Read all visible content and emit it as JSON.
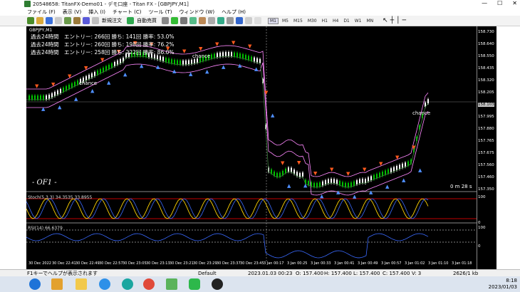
{
  "window": {
    "title": "20548658: TitanFX-Demo01 - デモ口座 - Titan FX - [GBPJPY,M1]",
    "minimize": "—",
    "maximize": "☐",
    "close": "✕"
  },
  "menu": [
    "ファイル (F)",
    "表示 (V)",
    "挿入 (I)",
    "チャート (C)",
    "ツール (T)",
    "ウィンドウ (W)",
    "ヘルプ (H)"
  ],
  "toolbar": {
    "new_order": "新規注文",
    "auto_trade": "自動売買",
    "timeframes": [
      "M1",
      "M5",
      "M15",
      "M30",
      "H1",
      "H4",
      "D1",
      "W1",
      "MN"
    ],
    "active_timeframe": "M1"
  },
  "chart": {
    "symbol_label": "GBPJPY,M1",
    "stats": [
      "過去24時間　エントリー: 266回  勝ち: 141回  勝率: 53.0%",
      "過去24時間　エントリー: 260回  勝ち: 198回  勝率: 76.2%",
      "過去24時間　エントリー: 258回  勝ち: 222回  勝率: 86.0%"
    ],
    "chance_labels": [
      "chance",
      "chance",
      "chance"
    ],
    "watermark": "- OF1 -",
    "countdown": "0 m 28 s",
    "current_price": "158.103",
    "stoch_label": "Stoch(5,3,3) 34.3535 33.8955",
    "rsi_label": "RSI(14) 66.6379",
    "price_ticks": [
      "158.730",
      "158.640",
      "158.550",
      "158.435",
      "158.320",
      "158.205",
      "158.103",
      "157.995",
      "157.880",
      "157.765",
      "157.675",
      "157.560",
      "157.460",
      "157.350"
    ],
    "osc_ticks": [
      "100",
      "0",
      "100",
      "0"
    ],
    "time_ticks": [
      "30 Dec 2022",
      "30 Dec 22:41",
      "30 Dec 22:49",
      "30 Dec 22:57",
      "30 Dec 23:05",
      "30 Dec 23:13",
      "30 Dec 23:21",
      "30 Dec 23:29",
      "30 Dec 23:37",
      "30 Dec 23:45",
      "3 Jan 00:17",
      "3 Jan 00:25",
      "3 Jan 00:33",
      "3 Jan 00:41",
      "3 Jan 00:49",
      "3 Jan 00:57",
      "3 Jan 01:02",
      "3 Jan 01:10",
      "3 Jan 01:18"
    ]
  },
  "status": {
    "help": "F1キーでヘルプが表示されます",
    "profile": "Default",
    "datetime": "2023.01.03 00:23",
    "open": "O: 157.400",
    "high": "H: 157.400",
    "low": "L: 157.400",
    "close": "C: 157.400",
    "volume": "V: 3",
    "traffic": "2626/1 kb"
  },
  "tray": {
    "time": "8:18",
    "date": "2023/01/03"
  },
  "colors": {
    "chart_bg": "#000000",
    "bull": "#00c000",
    "bear": "#ffffff",
    "arrow_up": "#4f8fff",
    "arrow_down": "#ff5a1e",
    "band": "#ff88ff"
  }
}
